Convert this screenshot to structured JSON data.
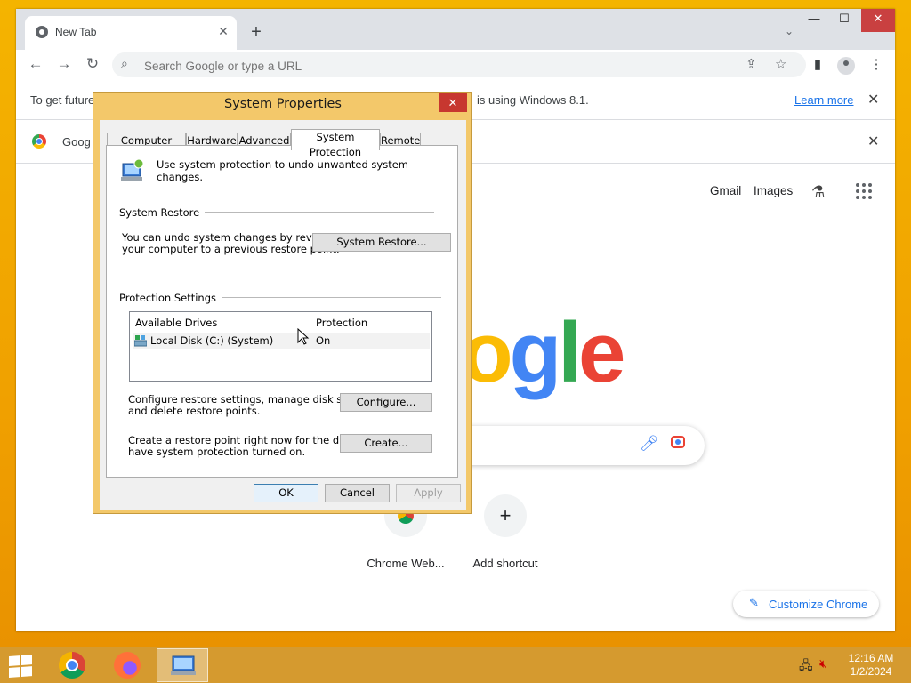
{
  "browser": {
    "tab": {
      "title": "New Tab",
      "close": "✕"
    },
    "new_tab": "+",
    "tab_search": "⌄",
    "window_controls": {
      "minimize": "—",
      "maximize": "☐",
      "close": "✕"
    },
    "nav": {
      "back": "←",
      "forward": "→",
      "reload": "↻"
    },
    "omnibox": {
      "placeholder": "Search Google or type a URL",
      "share_icon": "share-icon",
      "star_icon": "bookmark-star-icon"
    },
    "toolbar_icons": {
      "sidepanel": "▮",
      "menu": "⋮"
    },
    "infobar": {
      "text_left": "To get future",
      "text_right": "is using Windows 8.1.",
      "link": "Learn more",
      "close": "✕"
    },
    "infobar2": {
      "text": "Goog",
      "close": "✕"
    }
  },
  "ntp": {
    "links": {
      "gmail": "Gmail",
      "images": "Images"
    },
    "logo_letters": [
      "o",
      "g",
      "l",
      "e"
    ],
    "logo_colors": [
      "#fbbc05",
      "#4285f4",
      "#34a853",
      "#ea4335"
    ],
    "shortcuts": [
      {
        "label": "Chrome Web...",
        "icon": "chrome-web-store-icon"
      },
      {
        "label": "Add shortcut",
        "icon": "plus-icon",
        "glyph": "+"
      }
    ],
    "customize": {
      "label": "Customize Chrome",
      "icon": "pencil-icon",
      "glyph": "✎"
    }
  },
  "dialog": {
    "title": "System Properties",
    "close": "✕",
    "tabs": [
      "Computer Name",
      "Hardware",
      "Advanced",
      "System Protection",
      "Remote"
    ],
    "active_tab": "System Protection",
    "intro": "Use system protection to undo unwanted system changes.",
    "restore": {
      "group": "System Restore",
      "desc_line1": "You can undo system changes by reverting",
      "desc_line2": "your computer to a previous restore point.",
      "button": "System Restore..."
    },
    "protection": {
      "group": "Protection Settings",
      "columns": [
        "Available Drives",
        "Protection"
      ],
      "rows": [
        {
          "drive": "Local Disk (C:) (System)",
          "protection": "On"
        }
      ]
    },
    "configure": {
      "desc_line1": "Configure restore settings, manage disk space,",
      "desc_line2": "and delete restore points.",
      "button": "Configure..."
    },
    "create": {
      "desc_line1": "Create a restore point right now for the drives that",
      "desc_line2": "have system protection turned on.",
      "button": "Create..."
    },
    "footer": {
      "ok": "OK",
      "cancel": "Cancel",
      "apply": "Apply"
    }
  },
  "taskbar": {
    "apps": [
      "chrome-icon",
      "firefox-icon",
      "system-properties-icon"
    ],
    "clock": {
      "time": "12:16 AM",
      "date": "1/2/2024"
    }
  }
}
